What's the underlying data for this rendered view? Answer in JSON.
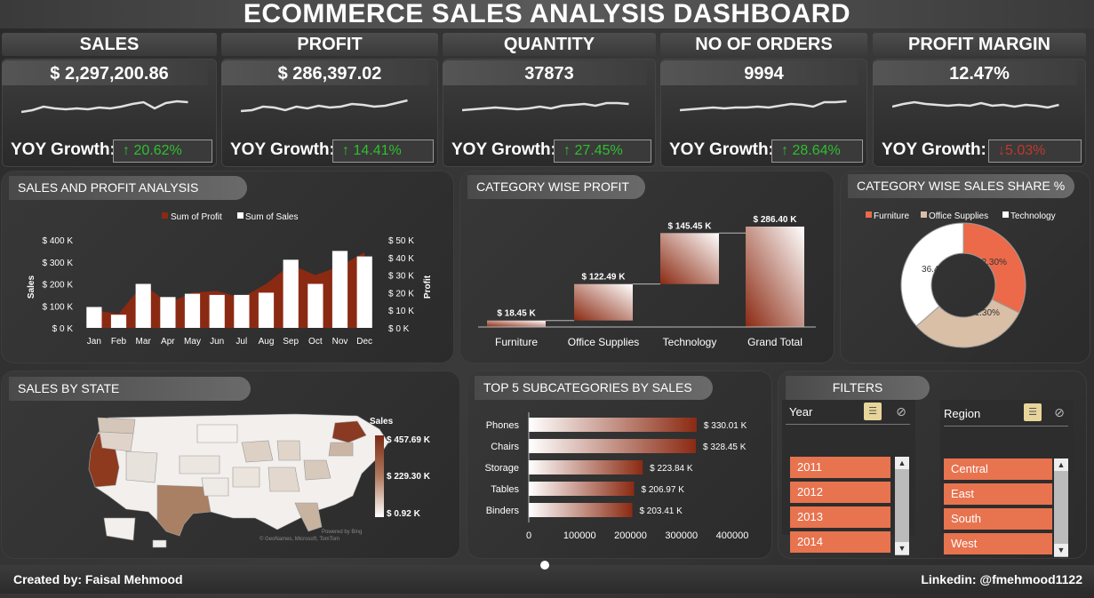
{
  "title": "ECOMMERCE SALES ANALYSIS DASHBOARD",
  "kpis": [
    {
      "label": "SALES",
      "value": "$ 2,297,200.86",
      "yoy_label": "YOY Growth:",
      "yoy": "↑ 20.62%",
      "yoy_color": "#2fbf2f",
      "spark": [
        18,
        16,
        12,
        14,
        15,
        14,
        15,
        13,
        14,
        12,
        9,
        7,
        14,
        8,
        6,
        7
      ]
    },
    {
      "label": "PROFIT",
      "value": "$ 286,397.02",
      "yoy_label": "YOY Growth:",
      "yoy": "↑ 14.41%",
      "yoy_color": "#2fbf2f",
      "spark": [
        17,
        16,
        12,
        13,
        16,
        12,
        14,
        11,
        13,
        12,
        9,
        10,
        12,
        11,
        8,
        5
      ]
    },
    {
      "label": "QUANTITY",
      "value": "37873",
      "yoy_label": "YOY Growth:",
      "yoy": "↑ 27.45%",
      "yoy_color": "#2fbf2f",
      "spark": [
        16,
        15,
        14,
        13,
        14,
        15,
        14,
        12,
        14,
        11,
        10,
        9,
        11,
        8,
        8,
        9
      ]
    },
    {
      "label": "NO OF ORDERS",
      "value": "9994",
      "yoy_label": "YOY Growth:",
      "yoy": "↑ 28.64%",
      "yoy_color": "#2fbf2f",
      "spark": [
        16,
        15,
        14,
        13,
        14,
        13,
        13,
        12,
        13,
        11,
        9,
        10,
        12,
        7,
        7,
        6
      ]
    },
    {
      "label": "PROFIT MARGIN",
      "value": "12.47%",
      "yoy_label": "YOY Growth:",
      "yoy": "↓5.03%",
      "yoy_color": "#c0392b",
      "spark": [
        12,
        9,
        7,
        9,
        10,
        11,
        10,
        11,
        8,
        11,
        10,
        12,
        10,
        11,
        13,
        10
      ]
    }
  ],
  "sales_profit": {
    "title": "SALES AND PROFIT ANALYSIS",
    "legend_profit": "Sum of Profit",
    "legend_sales": "Sum of Sales",
    "ylabel_left": "Sales",
    "ylabel_right": "Profit",
    "left_ticks": [
      "$ 400 K",
      "$ 300 K",
      "$ 200 K",
      "$ 100 K",
      "$ 0 K"
    ],
    "right_ticks": [
      "$ 50 K",
      "$ 40 K",
      "$ 30 K",
      "$ 20 K",
      "$ 10 K",
      "$ 0 K"
    ]
  },
  "category_profit": {
    "title": "CATEGORY WISE PROFIT",
    "categories": [
      "Furniture",
      "Office Supplies",
      "Technology",
      "Grand Total"
    ],
    "labels": [
      "$ 18.45 K",
      "$ 122.49 K",
      "$ 145.45 K",
      "$ 286.40 K"
    ]
  },
  "category_share": {
    "title": "CATEGORY WISE SALES SHARE %",
    "legend": [
      "Furniture",
      "Office Supplies",
      "Technology"
    ],
    "labels": [
      "32.30%",
      "31.30%",
      "36.40%"
    ],
    "colors": [
      "#ec6a4a",
      "#d9bfa5",
      "#ffffff"
    ]
  },
  "sales_by_state": {
    "title": "SALES BY STATE",
    "legend_title": "Sales",
    "legend_max": "$ 457.69 K",
    "legend_mid": "$ 229.30 K",
    "legend_min": "$ 0.92 K",
    "credit1": "Powered by Bing",
    "credit2": "© GeoNames, Microsoft, TomTom"
  },
  "top5": {
    "title": "TOP 5 SUBCATEGORIES BY SALES",
    "labels": [
      "$ 330.01 K",
      "$ 328.45 K",
      "$ 223.84 K",
      "$ 206.97 K",
      "$ 203.41 K"
    ],
    "x_ticks": [
      "0",
      "100000",
      "200000",
      "300000",
      "400000"
    ]
  },
  "filters": {
    "title": "FILTERS",
    "year_title": "Year",
    "years": [
      "2011",
      "2012",
      "2013",
      "2014"
    ],
    "region_title": "Region",
    "regions": [
      "Central",
      "East",
      "South",
      "West"
    ]
  },
  "footer": {
    "created_by": "Created by: Faisal Mehmood",
    "linkedin": "Linkedin: @fmehmood1122"
  },
  "chart_data": [
    {
      "type": "bar",
      "title": "SALES AND PROFIT ANALYSIS",
      "categories": [
        "Jan",
        "Feb",
        "Mar",
        "Apr",
        "May",
        "Jun",
        "Jul",
        "Aug",
        "Sep",
        "Oct",
        "Nov",
        "Dec"
      ],
      "series": [
        {
          "name": "Sum of Sales",
          "values": [
            95,
            60,
            200,
            140,
            155,
            150,
            150,
            160,
            310,
            200,
            350,
            325
          ]
        },
        {
          "name": "Sum of Profit",
          "values": [
            10,
            8,
            25,
            14,
            20,
            21,
            17,
            25,
            36,
            30,
            35,
            43
          ]
        }
      ],
      "ylim": [
        0,
        400
      ],
      "ylim_right": [
        0,
        50
      ],
      "ylabel": "Sales",
      "ylabel_right": "Profit",
      "units": "K"
    },
    {
      "type": "bar",
      "title": "CATEGORY WISE PROFIT",
      "categories": [
        "Furniture",
        "Office Supplies",
        "Technology",
        "Grand Total"
      ],
      "values": [
        18.45,
        104.04,
        145.45,
        286.4
      ],
      "cumulative": [
        18.45,
        122.49,
        267.94,
        286.4
      ]
    },
    {
      "type": "pie",
      "title": "CATEGORY WISE SALES SHARE %",
      "categories": [
        "Furniture",
        "Office Supplies",
        "Technology"
      ],
      "values": [
        32.3,
        31.3,
        36.4
      ]
    },
    {
      "type": "bar",
      "title": "TOP 5 SUBCATEGORIES BY SALES",
      "categories": [
        "Phones",
        "Chairs",
        "Storage",
        "Tables",
        "Binders"
      ],
      "values": [
        330010,
        328450,
        223840,
        206970,
        203410
      ],
      "xlim": [
        0,
        400000
      ]
    }
  ]
}
